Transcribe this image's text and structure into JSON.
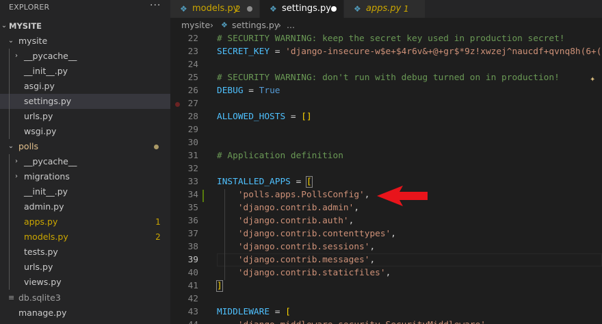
{
  "explorer": {
    "title": "EXPLORER",
    "more": "···",
    "root_label": "MYSITE",
    "items": [
      {
        "label": "mysite",
        "chevron": "down",
        "color": "#cccccc"
      },
      {
        "label": "__pycache__",
        "chevron": "right",
        "color": "#cccccc"
      },
      {
        "label": "__init__.py",
        "color": "#cccccc"
      },
      {
        "label": "asgi.py",
        "color": "#cccccc"
      },
      {
        "label": "settings.py",
        "color": "#cccccc",
        "selected": true
      },
      {
        "label": "urls.py",
        "color": "#cccccc"
      },
      {
        "label": "wsgi.py",
        "color": "#cccccc"
      },
      {
        "label": "polls",
        "chevron": "down",
        "color": "#e2c08d",
        "dot": true
      },
      {
        "label": "__pycache__",
        "chevron": "right",
        "color": "#cccccc"
      },
      {
        "label": "migrations",
        "chevron": "right",
        "color": "#cccccc"
      },
      {
        "label": "__init__.py",
        "color": "#cccccc"
      },
      {
        "label": "admin.py",
        "color": "#cccccc"
      },
      {
        "label": "apps.py",
        "color": "#cca700",
        "badge": "1"
      },
      {
        "label": "models.py",
        "color": "#cca700",
        "badge": "2"
      },
      {
        "label": "tests.py",
        "color": "#cccccc"
      },
      {
        "label": "urls.py",
        "color": "#cccccc"
      },
      {
        "label": "views.py",
        "color": "#cccccc"
      },
      {
        "label": "db.sqlite3",
        "color": "#a0a0a0"
      },
      {
        "label": "manage.py",
        "color": "#cccccc"
      }
    ]
  },
  "tabs": [
    {
      "label": "models.py",
      "badge": "2",
      "label_color": "#cca700",
      "dot_color": "#8b8b8b"
    },
    {
      "label": "settings.py",
      "label_color": "#ffffff",
      "dot_color": "#ffffff",
      "active": true
    },
    {
      "label": "apps.py",
      "badge": "1",
      "label_color": "#cca700"
    }
  ],
  "breadcrumb": {
    "folder": "mysite",
    "sep1": "›",
    "file": "settings.py",
    "sep2": "›",
    "more": "..."
  },
  "editor": {
    "current_line": "39",
    "lines": [
      {
        "n": "22",
        "tokens": [
          {
            "t": "# SECURITY WARNING: keep the secret key used in production secret!",
            "c": "comment"
          }
        ]
      },
      {
        "n": "23",
        "tokens": [
          {
            "t": "SECRET_KEY",
            "c": "var"
          },
          {
            "t": " = ",
            "c": "op"
          },
          {
            "t": "'django-insecure-w$e+$4r6v&+@+gr$*9z!xwzej^naucdf+qvnq8h(6+(",
            "c": "str"
          }
        ]
      },
      {
        "n": "24",
        "tokens": []
      },
      {
        "n": "25",
        "tokens": [
          {
            "t": "# SECURITY WARNING: don't run with debug turned on in production!",
            "c": "comment"
          }
        ]
      },
      {
        "n": "26",
        "tokens": [
          {
            "t": "DEBUG",
            "c": "var"
          },
          {
            "t": " = ",
            "c": "op"
          },
          {
            "t": "True",
            "c": "kw"
          }
        ]
      },
      {
        "n": "27",
        "tokens": []
      },
      {
        "n": "28",
        "tokens": [
          {
            "t": "ALLOWED_HOSTS",
            "c": "var"
          },
          {
            "t": " = ",
            "c": "op"
          },
          {
            "t": "[]",
            "c": "bracket"
          }
        ]
      },
      {
        "n": "29",
        "tokens": []
      },
      {
        "n": "30",
        "tokens": []
      },
      {
        "n": "31",
        "tokens": [
          {
            "t": "# Application definition",
            "c": "comment"
          }
        ]
      },
      {
        "n": "32",
        "tokens": []
      },
      {
        "n": "33",
        "tokens": [
          {
            "t": "INSTALLED_APPS",
            "c": "var"
          },
          {
            "t": " = ",
            "c": "op"
          },
          {
            "t": "[",
            "c": "bracket",
            "box": true
          }
        ]
      },
      {
        "n": "34",
        "tokens": [
          {
            "t": "    ",
            "c": "op"
          },
          {
            "t": "'polls.apps.PollsConfig'",
            "c": "str"
          },
          {
            "t": ",",
            "c": "op"
          }
        ]
      },
      {
        "n": "35",
        "tokens": [
          {
            "t": "    ",
            "c": "op"
          },
          {
            "t": "'django.contrib.admin'",
            "c": "str"
          },
          {
            "t": ",",
            "c": "op"
          }
        ]
      },
      {
        "n": "36",
        "tokens": [
          {
            "t": "    ",
            "c": "op"
          },
          {
            "t": "'django.contrib.auth'",
            "c": "str"
          },
          {
            "t": ",",
            "c": "op"
          }
        ]
      },
      {
        "n": "37",
        "tokens": [
          {
            "t": "    ",
            "c": "op"
          },
          {
            "t": "'django.contrib.contenttypes'",
            "c": "str"
          },
          {
            "t": ",",
            "c": "op"
          }
        ]
      },
      {
        "n": "38",
        "tokens": [
          {
            "t": "    ",
            "c": "op"
          },
          {
            "t": "'django.contrib.sessions'",
            "c": "str"
          },
          {
            "t": ",",
            "c": "op"
          }
        ]
      },
      {
        "n": "39",
        "tokens": [
          {
            "t": "    ",
            "c": "op"
          },
          {
            "t": "'django.contrib.messages'",
            "c": "str"
          },
          {
            "t": ",",
            "c": "op"
          }
        ]
      },
      {
        "n": "40",
        "tokens": [
          {
            "t": "    ",
            "c": "op"
          },
          {
            "t": "'django.contrib.staticfiles'",
            "c": "str"
          },
          {
            "t": ",",
            "c": "op"
          }
        ]
      },
      {
        "n": "41",
        "tokens": [
          {
            "t": "]",
            "c": "bracket",
            "box": true
          }
        ]
      },
      {
        "n": "42",
        "tokens": []
      },
      {
        "n": "43",
        "tokens": [
          {
            "t": "MIDDLEWARE",
            "c": "var"
          },
          {
            "t": " = ",
            "c": "op"
          },
          {
            "t": "[",
            "c": "bracket"
          }
        ]
      },
      {
        "n": "44",
        "tokens": [
          {
            "t": "    'django.middleware.security.SecurityMiddleware',",
            "c": "str"
          }
        ]
      }
    ]
  },
  "annotation": {
    "icon": "red-arrow-icon",
    "color": "#e8141b"
  },
  "icons": {
    "python": "python-file-icon",
    "database": "database-file-icon"
  }
}
